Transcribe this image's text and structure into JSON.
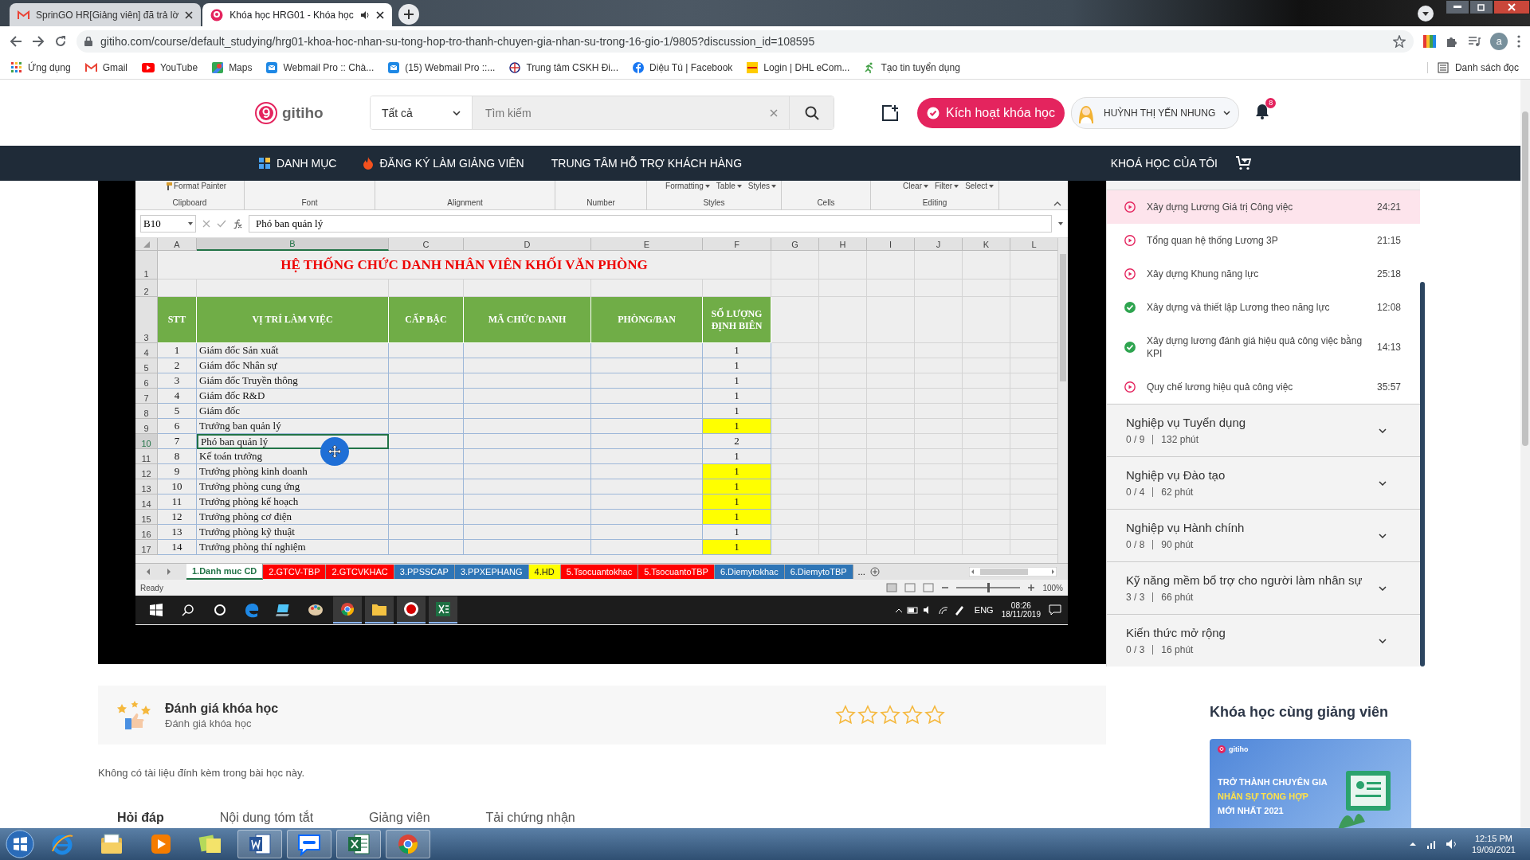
{
  "browser": {
    "tabs": [
      {
        "title": "SprinGO HR[Giảng viên] đã trả lờ",
        "kind": "gmail",
        "selected": false,
        "audio": false
      },
      {
        "title": "Khóa học HRG01 - Khóa học",
        "kind": "gitiho",
        "selected": true,
        "audio": true
      }
    ],
    "url": "gitiho.com/course/default_studying/hrg01-khoa-hoc-nhan-su-tong-hop-tro-thanh-chuyen-gia-nhan-su-trong-16-gio-1/9805?discussion_id=108595",
    "profile_initial": "a",
    "bookmarks": [
      {
        "label": "Ứng dụng",
        "kind": "apps"
      },
      {
        "label": "Gmail",
        "kind": "gmail"
      },
      {
        "label": "YouTube",
        "kind": "youtube"
      },
      {
        "label": "Maps",
        "kind": "maps"
      },
      {
        "label": "Webmail Pro :: Chà...",
        "kind": "mail"
      },
      {
        "label": "(15) Webmail Pro ::...",
        "kind": "mail"
      },
      {
        "label": "Trung tâm CSKH Đi...",
        "kind": "power"
      },
      {
        "label": "Diệu Tú | Facebook",
        "kind": "facebook"
      },
      {
        "label": "Login | DHL eCom...",
        "kind": "dhl"
      },
      {
        "label": "Tạo tin tuyển dụng",
        "kind": "runner"
      }
    ],
    "reading_list": "Danh sách đọc"
  },
  "site": {
    "logo": "gitiho",
    "search": {
      "category": "Tất cả",
      "placeholder": "Tìm kiếm"
    },
    "activate_button": "Kích hoạt khóa học",
    "user_name": "HUỲNH THỊ YẾN NHUNG",
    "notification_count": "8"
  },
  "nav": {
    "items": [
      {
        "label": "DANH MỤC",
        "kind": "grid"
      },
      {
        "label": "ĐĂNG KÝ LÀM GIẢNG VIÊN",
        "kind": "fire"
      },
      {
        "label": "TRUNG TÂM HỖ TRỢ KHÁCH HÀNG"
      }
    ],
    "my_courses": "KHOÁ HỌC CỦA TÔI"
  },
  "video": {
    "ribbon": [
      {
        "label": "Clipboard",
        "items": [
          "Format Painter"
        ]
      },
      {
        "label": "Font"
      },
      {
        "label": "Alignment"
      },
      {
        "label": "Number"
      },
      {
        "label": "Styles",
        "items": [
          "Formatting",
          "Table",
          "Styles"
        ]
      },
      {
        "label": "Cells"
      },
      {
        "label": "Editing",
        "items": [
          "Clear",
          "Filter",
          "Select"
        ]
      }
    ],
    "name_box": "B10",
    "formula": "Phó ban quản lý",
    "columns": [
      {
        "label": "A",
        "selected": false
      },
      {
        "label": "B",
        "selected": true
      },
      {
        "label": "C",
        "selected": false
      },
      {
        "label": "D",
        "selected": false
      },
      {
        "label": "E",
        "selected": false
      },
      {
        "label": "F",
        "selected": false
      },
      {
        "label": "G",
        "selected": false
      },
      {
        "label": "H",
        "selected": false
      },
      {
        "label": "I",
        "selected": false
      },
      {
        "label": "J",
        "selected": false
      },
      {
        "label": "K",
        "selected": false
      },
      {
        "label": "L",
        "selected": false
      }
    ],
    "title_row": {
      "number": "1",
      "text": "HỆ THỐNG CHỨC DANH NHÂN VIÊN KHỐI VĂN PHÒNG"
    },
    "blank_row": {
      "number": "2"
    },
    "header_row": {
      "number": "3",
      "cells": [
        "STT",
        "VỊ TRÍ LÀM VIỆC",
        "CẤP BẬC",
        "MÃ CHỨC DANH",
        "PHÒNG/BAN",
        "SỐ LƯỢNG ĐỊNH BIÊN"
      ]
    },
    "rows": [
      {
        "number": "4",
        "stt": "1",
        "position": "Giám đốc Sản xuất",
        "quota": "1",
        "highlighted": false,
        "selected": false
      },
      {
        "number": "5",
        "stt": "2",
        "position": "Giám đốc Nhân sự",
        "quota": "1",
        "highlighted": false,
        "selected": false
      },
      {
        "number": "6",
        "stt": "3",
        "position": "Giám đốc Truyền thông",
        "quota": "1",
        "highlighted": false,
        "selected": false
      },
      {
        "number": "7",
        "stt": "4",
        "position": "Giám đốc R&D",
        "quota": "1",
        "highlighted": false,
        "selected": false
      },
      {
        "number": "8",
        "stt": "5",
        "position": "Giám đốc",
        "quota": "1",
        "highlighted": false,
        "selected": false
      },
      {
        "number": "9",
        "stt": "6",
        "position": "Trưởng ban quản lý",
        "quota": "1",
        "highlighted": true,
        "selected": false
      },
      {
        "number": "10",
        "stt": "7",
        "position": "Phó ban quản lý",
        "quota": "2",
        "highlighted": false,
        "selected": true
      },
      {
        "number": "11",
        "stt": "8",
        "position": "Kế toán trưởng",
        "quota": "1",
        "highlighted": false,
        "selected": false
      },
      {
        "number": "12",
        "stt": "9",
        "position": "Trưởng phòng kinh doanh",
        "quota": "1",
        "highlighted": true,
        "selected": false
      },
      {
        "number": "13",
        "stt": "10",
        "position": "Trưởng phòng cung ứng",
        "quota": "1",
        "highlighted": true,
        "selected": false
      },
      {
        "number": "14",
        "stt": "11",
        "position": "Trưởng phòng kế hoạch",
        "quota": "1",
        "highlighted": true,
        "selected": false
      },
      {
        "number": "15",
        "stt": "12",
        "position": "Trưởng phòng cơ điện",
        "quota": "1",
        "highlighted": true,
        "selected": false
      },
      {
        "number": "16",
        "stt": "13",
        "position": "Trưởng phòng kỹ thuật",
        "quota": "1",
        "highlighted": false,
        "selected": false
      },
      {
        "number": "17",
        "stt": "14",
        "position": "Trưởng phòng thí nghiệm",
        "quota": "1",
        "highlighted": true,
        "selected": false
      }
    ],
    "sheet_tabs": [
      {
        "label": "1.Danh muc CD",
        "color": "#217346",
        "selected": true
      },
      {
        "label": "2.GTCV-TBP",
        "color": "#ff0000",
        "selected": false
      },
      {
        "label": "2.GTCVKHAC",
        "color": "#ff0000",
        "selected": false
      },
      {
        "label": "3.PPSSCAP",
        "color": "#2e75b6",
        "selected": false
      },
      {
        "label": "3.PPXEPHANG",
        "color": "#2e75b6",
        "selected": false
      },
      {
        "label": "4.HD",
        "color": "#ffff00",
        "selected": false
      },
      {
        "label": "5.Tsocuantokhac",
        "color": "#ff0000",
        "selected": false
      },
      {
        "label": "5.TsocuantoTBP",
        "color": "#ff0000",
        "selected": false
      },
      {
        "label": "6.Diemytokhac",
        "color": "#2e75b6",
        "selected": false
      },
      {
        "label": "6.DiemytoTBP",
        "color": "#2e75b6",
        "selected": false
      }
    ],
    "more_tabs": "...",
    "status": "Ready",
    "zoom_slider": {
      "level": 0.5
    },
    "zoom": "100%",
    "taskbar": {
      "language": "ENG",
      "time": "08:26",
      "date": "18/11/2019"
    }
  },
  "sidebar": {
    "lessons": [
      {
        "title": "Xây dựng Lương Giá trị Công việc",
        "duration": "24:21",
        "done": false,
        "selected": true
      },
      {
        "title": "Tổng quan hệ thống Lương 3P",
        "duration": "21:15",
        "done": false,
        "selected": false
      },
      {
        "title": "Xây dựng Khung năng lực",
        "duration": "25:18",
        "done": false,
        "selected": false
      },
      {
        "title": "Xây dựng và thiết lập Lương theo năng lực",
        "duration": "12:08",
        "done": true,
        "selected": false
      },
      {
        "title": "Xây dựng lương đánh giá hiệu quả công việc bằng KPI",
        "duration": "14:13",
        "done": true,
        "selected": false
      },
      {
        "title": "Quy chế lương hiệu quả công việc",
        "duration": "35:57",
        "done": false,
        "selected": false
      }
    ],
    "sections": [
      {
        "title": "Nghiệp vụ Tuyển dụng",
        "progress": "0 / 9",
        "duration": "132 phút",
        "expanded": false
      },
      {
        "title": "Nghiệp vụ Đào tạo",
        "progress": "0 / 4",
        "duration": "62 phút",
        "expanded": false
      },
      {
        "title": "Nghiệp vụ Hành chính",
        "progress": "0 / 8",
        "duration": "90 phút",
        "expanded": false
      },
      {
        "title": "Kỹ năng mềm bổ trợ cho người làm nhân sự",
        "progress": "3 / 3",
        "duration": "66 phút",
        "expanded": false
      },
      {
        "title": "Kiến thức mở rộng",
        "progress": "0 / 3",
        "duration": "16 phút",
        "expanded": false
      }
    ]
  },
  "rating": {
    "title": "Đánh giá khóa học",
    "subtitle": "Đánh giá khóa học",
    "stars": 0
  },
  "attachments_note": "Không có tài liệu đính kèm trong bài học này.",
  "content_tabs": [
    {
      "label": "Hỏi đáp",
      "selected": true
    },
    {
      "label": "Nội dung tóm tắt",
      "selected": false
    },
    {
      "label": "Giảng viên",
      "selected": false
    },
    {
      "label": "Tải chứng nhận",
      "selected": false
    }
  ],
  "related": {
    "heading": "Khóa học cùng giảng viên",
    "card": {
      "brand": "gitiho",
      "lines": [
        {
          "text": "TRỞ THÀNH CHUYÊN GIA",
          "highlight": false
        },
        {
          "text": "NHÂN SỰ TỔNG HỢP",
          "highlight": true
        },
        {
          "text": "MỚI NHẤT 2021",
          "highlight": false
        }
      ]
    }
  },
  "taskbar": {
    "apps": [
      {
        "kind": "ie",
        "running": false
      },
      {
        "kind": "explorer",
        "running": false
      },
      {
        "kind": "media",
        "running": false
      },
      {
        "kind": "notes",
        "running": false
      },
      {
        "kind": "word",
        "running": true
      },
      {
        "kind": "zalo",
        "running": true
      },
      {
        "kind": "excel",
        "running": true
      },
      {
        "kind": "chrome",
        "running": true
      }
    ],
    "time": "12:15 PM",
    "date": "19/09/2021"
  }
}
